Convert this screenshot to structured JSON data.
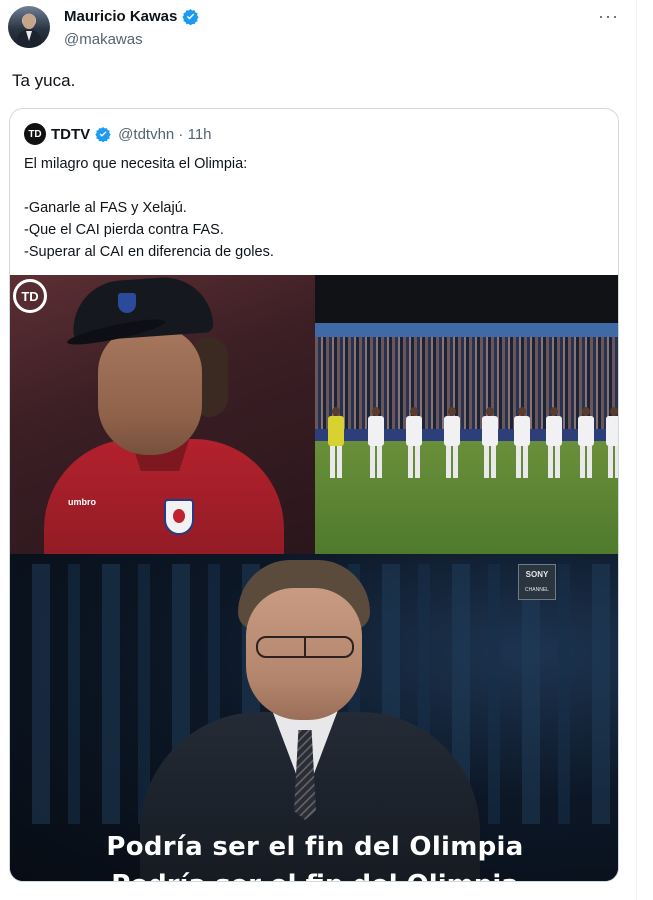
{
  "author": {
    "display_name": "Mauricio Kawas",
    "handle": "@makawas",
    "more_label": "···"
  },
  "tweet": {
    "text": "Ta yuca."
  },
  "quoted": {
    "logo_text": "TD",
    "display_name": "TDTV",
    "handle_time": "@tdtvhn · 11h",
    "lines": [
      "El milagro que necesita el Olimpia:",
      "",
      "-Ganarle al FAS y Xelajú.",
      "-Que el CAI pierda contra FAS.",
      "-Superar al CAI en diferencia de goles."
    ],
    "media": {
      "watermark": "TD",
      "kit_brand": "umbro",
      "channel_logo": "SONY",
      "channel_sub": "CHANNEL",
      "caption": "Podría ser el fin del Olimpia",
      "caption_partial": "Podría ser el fin del Olimpia"
    }
  },
  "colors": {
    "verified": "#1d9bf0",
    "text_primary": "#0f1419",
    "text_secondary": "#536471",
    "border": "#cfd9de"
  }
}
